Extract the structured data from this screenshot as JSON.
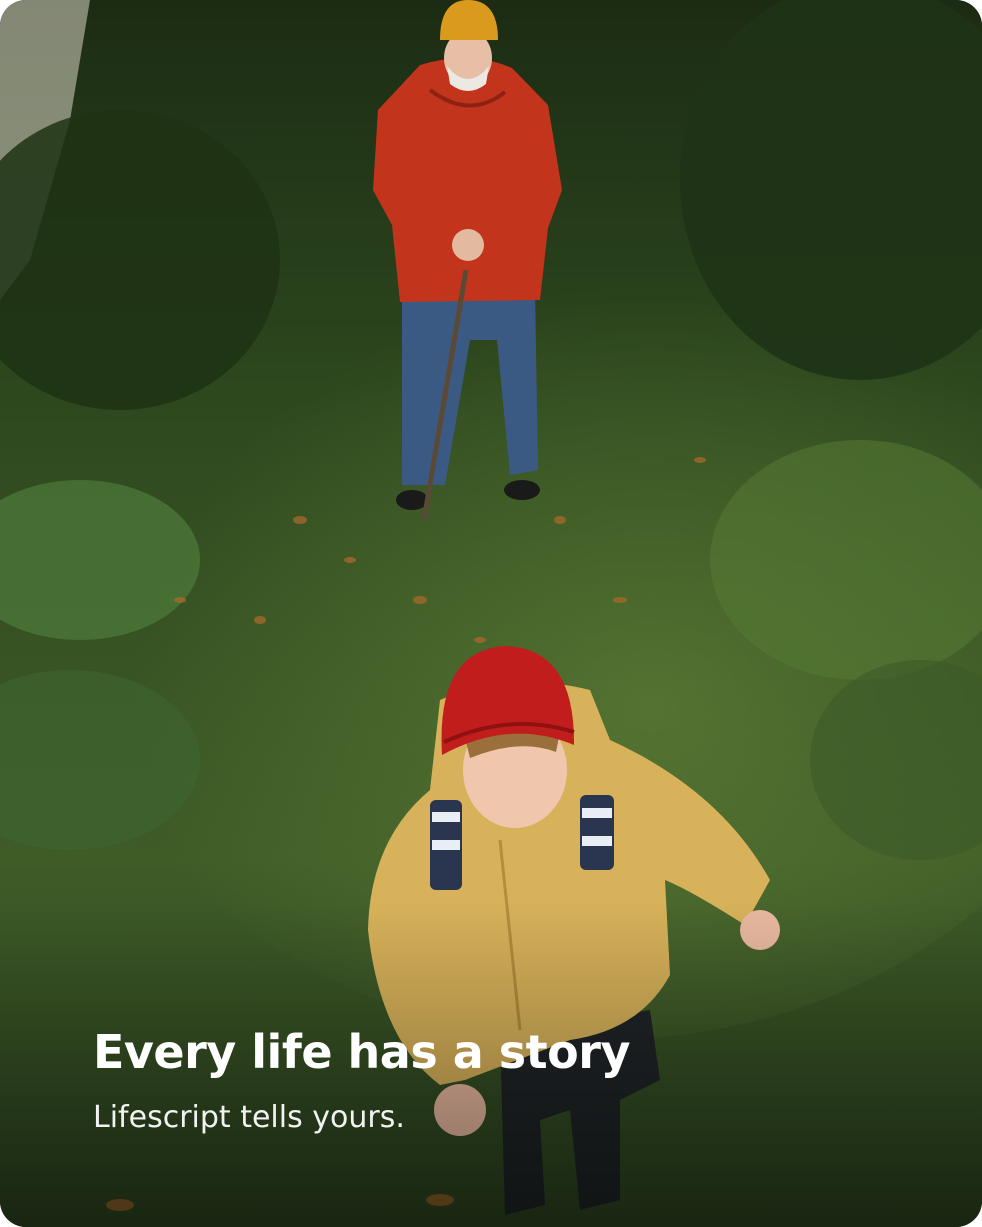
{
  "hero": {
    "headline": "Every life has a story",
    "subline": "Lifescript tells yours.",
    "text_color": "#ffffff"
  },
  "photo": {
    "description_tags": [
      "grassy-path",
      "elderly-man-red-jacket",
      "boy-yellow-coat"
    ],
    "colors": {
      "grass_dark": "#23361a",
      "grass_light": "#4d6b2f",
      "red_jacket": "#c2341c",
      "yellow_beanie": "#d99a1e",
      "yellow_coat": "#d8b25a",
      "red_beanie": "#c21d1d",
      "jeans": "#3b5a83"
    }
  }
}
